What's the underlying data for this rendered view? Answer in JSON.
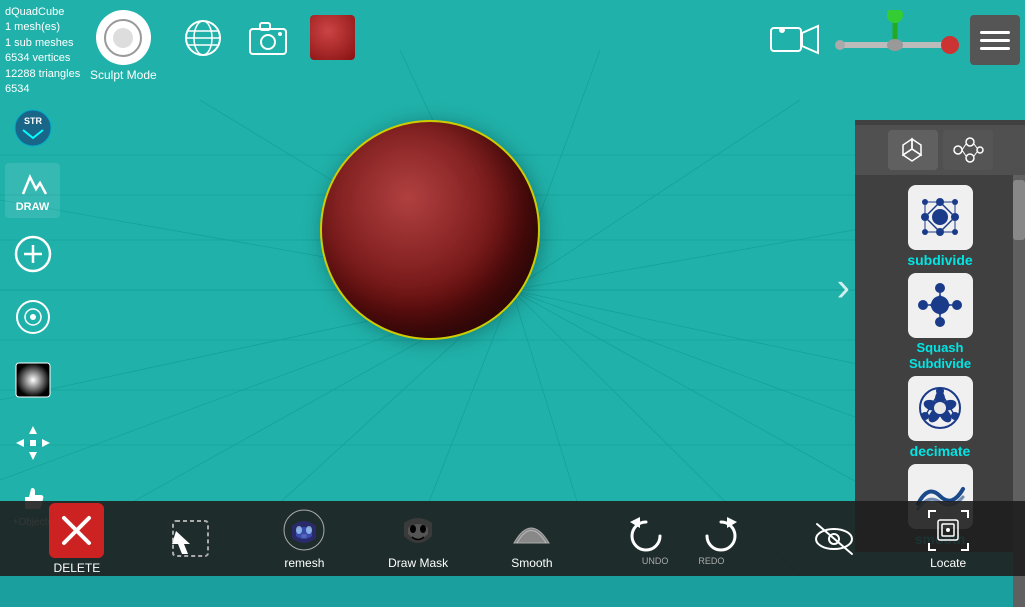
{
  "app": {
    "title": "dQuadCube",
    "mesh_info": {
      "line1": "dQuadCube",
      "line2": "1 mesh(es)",
      "line3": "1 sub meshes",
      "line4": "6534 vertices",
      "line5": "12288 triangles",
      "line6": "6534"
    },
    "sculpt_mode_label": "Sculpt Mode"
  },
  "toolbar": {
    "draw_label": "DRAW",
    "add_objects_label": "+Objects",
    "delete_label": "DELETE"
  },
  "right_panel": {
    "tools": [
      {
        "id": "subdivide",
        "label": "subdivide"
      },
      {
        "id": "squash_subdivide",
        "label": "Squash\nSubdivide"
      },
      {
        "id": "decimate",
        "label": "decimate"
      },
      {
        "id": "smooth",
        "label": "smooth"
      }
    ]
  },
  "bottom_bar": {
    "buttons": [
      {
        "id": "delete",
        "label": "DELETE"
      },
      {
        "id": "select",
        "label": ""
      },
      {
        "id": "remesh",
        "label": "remesh"
      },
      {
        "id": "draw_mask",
        "label": "Draw Mask"
      },
      {
        "id": "smooth",
        "label": "Smooth"
      },
      {
        "id": "undo",
        "label": "UNDO"
      },
      {
        "id": "redo",
        "label": "REDO"
      },
      {
        "id": "hide_show",
        "label": ""
      },
      {
        "id": "locate",
        "label": "Locate"
      }
    ]
  },
  "icons": {
    "globe": "🌐",
    "camera": "📷",
    "video": "🎥",
    "menu": "☰",
    "arrow_right": "›",
    "draw": "✏",
    "add_circle": "+",
    "dot": "●",
    "brightness": "◐",
    "arrows": "⊹",
    "thumbs_up": "👍",
    "x_mark": "✕",
    "undo_arrow": "↩",
    "redo_arrow": "↪",
    "eye_slash": "🚫",
    "location": "📍"
  },
  "colors": {
    "viewport_bg": "#20b2aa",
    "panel_bg": "#404040",
    "panel_header": "#505050",
    "accent_cyan": "#00e5e5",
    "bottom_bar_bg": "#1e1e1e",
    "delete_red": "#cc2222",
    "sphere_color": "#6b1010"
  }
}
